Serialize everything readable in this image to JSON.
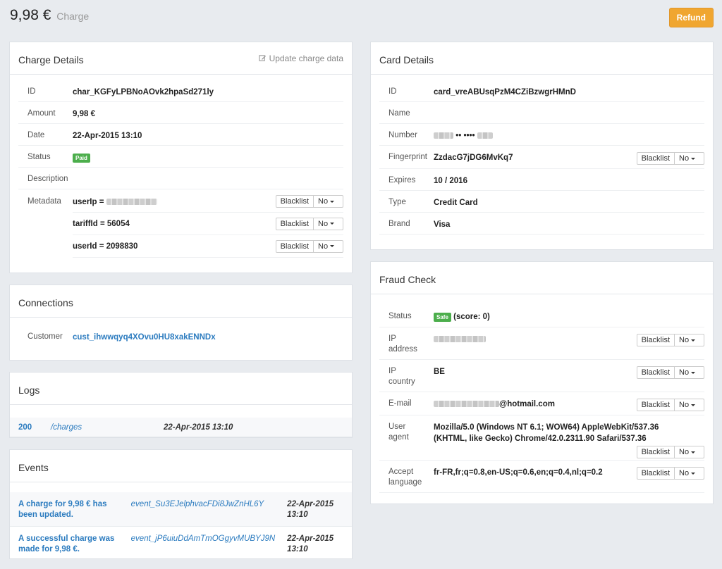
{
  "header": {
    "amount": "9,98 €",
    "subtitle": "Charge",
    "refund_label": "Refund"
  },
  "colors": {
    "accent": "#f0a630",
    "link": "#2b7bbf",
    "success": "#4cae4c"
  },
  "charge_details": {
    "title": "Charge Details",
    "update_link": "Update charge data",
    "rows": {
      "id": {
        "label": "ID",
        "value": "char_KGFyLPBNoAOvk2hpaSd271ly"
      },
      "amount": {
        "label": "Amount",
        "value": "9,98 €"
      },
      "date": {
        "label": "Date",
        "value": "22-Apr-2015 13:10"
      },
      "status": {
        "label": "Status",
        "badge": "Paid"
      },
      "description": {
        "label": "Description",
        "value": ""
      },
      "metadata": {
        "label": "Metadata"
      }
    },
    "metadata": [
      {
        "key": "userIp =",
        "value": ""
      },
      {
        "key": "tariffId = 56054",
        "value": ""
      },
      {
        "key": "userId = 2098830",
        "value": ""
      }
    ],
    "blacklist_label": "Blacklist",
    "no_label": "No"
  },
  "connections": {
    "title": "Connections",
    "customer_label": "Customer",
    "customer_value": "cust_ihwwqyq4XOvu0HU8xakENNDx"
  },
  "logs": {
    "title": "Logs",
    "entries": [
      {
        "status": "200",
        "path": "/charges",
        "date": "22-Apr-2015 13:10"
      }
    ]
  },
  "events": {
    "title": "Events",
    "entries": [
      {
        "desc_line1": "A charge for 9,98 € has",
        "desc_line2": "been updated.",
        "id": "event_Su3EJelphvacFDi8JwZnHL6Y",
        "date_line1": "22-Apr-2015",
        "date_line2": "13:10"
      },
      {
        "desc_line1": "A successful charge was",
        "desc_line2": "made for 9,98 €.",
        "id": "event_jP6uiuDdAmTmOGgyvMUBYJ9N",
        "date_line1": "22-Apr-2015",
        "date_line2": "13:10"
      }
    ]
  },
  "card_details": {
    "title": "Card Details",
    "rows": {
      "id": {
        "label": "ID",
        "value": "card_vreABUsqPzM4CZiBzwgrHMnD"
      },
      "name": {
        "label": "Name",
        "value": ""
      },
      "number": {
        "label": "Number",
        "value": "•• ••••"
      },
      "fingerprint": {
        "label": "Fingerprint",
        "value": "ZzdacG7jDG6MvKq7"
      },
      "expires": {
        "label": "Expires",
        "value": "10 / 2016"
      },
      "type": {
        "label": "Type",
        "value": "Credit Card"
      },
      "brand": {
        "label": "Brand",
        "value": "Visa"
      }
    }
  },
  "fraud_check": {
    "title": "Fraud Check",
    "status_label": "Status",
    "status_badge": "Safe",
    "score": "(score: 0)",
    "ip_label_1": "IP",
    "ip_label_2": "address",
    "country_label_1": "IP",
    "country_label_2": "country",
    "country_value": "BE",
    "email_label": "E-mail",
    "email_value": "@hotmail.com",
    "agent_label_1": "User",
    "agent_label_2": "agent",
    "agent_value_1": "Mozilla/5.0 (Windows NT 6.1; WOW64) AppleWebKit/537.36",
    "agent_value_2": "(KHTML, like Gecko) Chrome/42.0.2311.90 Safari/537.36",
    "lang_label_1": "Accept",
    "lang_label_2": "language",
    "lang_value": "fr-FR,fr;q=0.8,en-US;q=0.6,en;q=0.4,nl;q=0.2"
  }
}
